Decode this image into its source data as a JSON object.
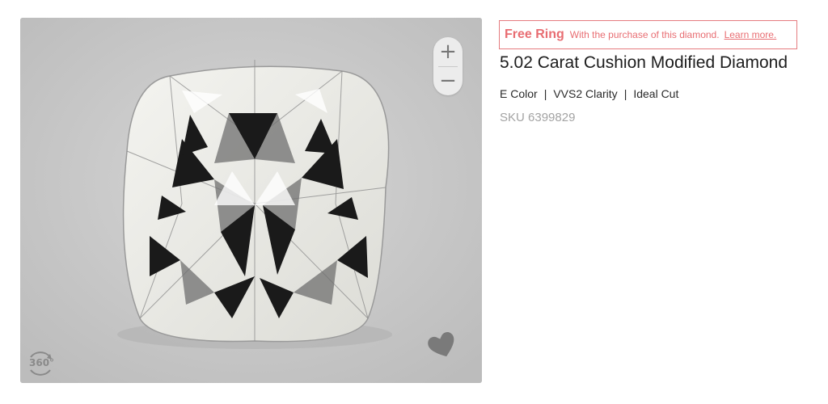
{
  "viewer": {
    "zoom_in_label": "+",
    "zoom_out_label": "−",
    "rotate_label": "360°",
    "icons": {
      "zoom_in": "plus-icon",
      "zoom_out": "minus-icon",
      "rotate": "rotate-360-icon",
      "favorite": "heart-icon"
    }
  },
  "promo": {
    "title": "Free Ring",
    "description": "With the purchase of this diamond.",
    "link": "Learn more."
  },
  "product": {
    "title": "5.02 Carat Cushion Modified Diamond",
    "specs": [
      "E Color",
      "VVS2 Clarity",
      "Ideal Cut"
    ],
    "separator": "|",
    "sku": "SKU 6399829"
  },
  "colors": {
    "accent": "#e86d72",
    "viewer_bg": "#c9c9c9",
    "sku_text": "#a3a3a3"
  }
}
